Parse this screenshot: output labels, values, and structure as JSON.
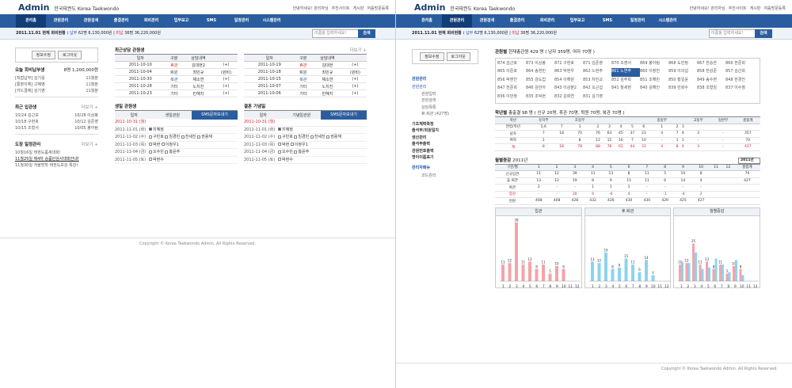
{
  "brand": {
    "admin": "Admin",
    "name_ko": "한국태권도",
    "name_en": "Korea Taekwondo"
  },
  "toplinks": [
    "안녕하세요! 관리자님",
    "추천사이트",
    "게시판",
    "처음방문등록"
  ],
  "menu": [
    "관리홈",
    "관원관리",
    "관원검색",
    "출결관리",
    "회비관리",
    "업무보고",
    "SMS",
    "일정관리",
    "시스템관리"
  ],
  "status": {
    "date": "2011.11.01 현재 회비현황 :",
    "paid_label": "납부",
    "paid": "62명",
    "paid_amt": "6,130,000원",
    "unpaid_label": "미납",
    "unpaid": "36명",
    "unpaid_amt": "36,220,000원"
  },
  "search": {
    "placeholder": "이름을 입력하세요!",
    "btn": "검색"
  },
  "login": {
    "edit": "정보수정",
    "logout": "로그아웃"
  },
  "fee_today": {
    "title": "오늘 회비납부생",
    "summary": "8명 1,200,000원",
    "rows": [
      [
        "[직접납부] 김기웅",
        "11월분"
      ],
      [
        "[통장이체] 고혜영",
        "11월분"
      ],
      [
        "[카드결제] 김기영",
        "11월분"
      ]
    ]
  },
  "new_students": {
    "title": "최근 입관생",
    "more": "더보기 +",
    "rows": [
      [
        "10/24 김근모",
        "10/28 이상봉"
      ],
      [
        "10/18 구현호",
        "10/12 김준영"
      ],
      [
        "10/15 조형서",
        "10/05 봉아림"
      ]
    ]
  },
  "schedule": {
    "title": "도장 일정관리",
    "more": "더보기 +",
    "rows": [
      "10월16일 태권도품새대회!",
      "11월25일 제4차 승품단심사대회안내!",
      "11월30일 겨울방학 태권도보강 특강!"
    ]
  },
  "consult": {
    "title": "최근상담 관원생",
    "more": "더보기 +",
    "cols": [
      "일자",
      "구분",
      "상담내역"
    ],
    "left": [
      [
        "2011-10-10",
        "휴관",
        "김대현2",
        "(+)"
      ],
      [
        "2011-10-04",
        "퇴원",
        "최민규",
        "(원비)"
      ],
      [
        "2011-10-30",
        "복관",
        "채소연",
        "(+)"
      ],
      [
        "2011-10-28",
        "기타",
        "노치진",
        "(+)"
      ],
      [
        "2011-10-23",
        "기타",
        "민혜지",
        "(+)"
      ]
    ],
    "right": [
      [
        "2011-10-19",
        "휴관",
        "김대현",
        "(+)"
      ],
      [
        "2011-10-18",
        "퇴원",
        "최민규",
        "(원비)"
      ],
      [
        "2011-10-15",
        "복관",
        "채소연",
        "(+)"
      ],
      [
        "2011-10-07",
        "기타",
        "노치진",
        "(+)"
      ],
      [
        "2011-10-06",
        "기타",
        "민혜지",
        "(+)"
      ]
    ]
  },
  "birthday": {
    "title": "생일 관원생",
    "cols": [
      "일자",
      "생일관원"
    ],
    "sms": "SMS문자보내기",
    "rows": [
      [
        "2011-10-31 (월)",
        ""
      ],
      [
        "2011-11-01 (화)",
        "지혜정"
      ],
      [
        "2011-11-02 (수)",
        "구민호  임경민  천세진  권용재"
      ],
      [
        "2011-11-03 (목)",
        "박현  이정우1"
      ],
      [
        "2011-11-04 (금)",
        "오수민  홍윤주"
      ],
      [
        "2011-11-05 (토)",
        "박현수"
      ]
    ]
  },
  "anniv": {
    "title": "결혼 기념일",
    "cols": [
      "일자",
      "기념일관원"
    ],
    "sms": "SMS문자보내기",
    "rows": [
      [
        "2011-10-31 (월)",
        ""
      ],
      [
        "2011-11-01 (화)",
        "지혜정"
      ],
      [
        "2011-11-02 (수)",
        "구민호  임경민  천세진  권용재"
      ],
      [
        "2011-11-03 (목)",
        "박현  이정우1"
      ],
      [
        "2011-11-04 (금)",
        "오수민  홍윤주"
      ],
      [
        "2011-11-05 (토)",
        "박현수"
      ]
    ]
  },
  "footer": "Copyright © Korea Taekwondo Admin. All Rights Reserved.",
  "rside": {
    "hd1": "관원관리",
    "items": [
      "관원관리",
      "관원입력",
      "관원검색",
      "상담목록",
      "휴.퇴관 (427명)"
    ],
    "bold": [
      "기초체력측정",
      "출석부/회원일지",
      "생산관리",
      "출석부출력",
      "관원번호출력",
      "명이이름표기"
    ],
    "hd2": "관리자메뉴",
    "items2": [
      "코드관리"
    ]
  },
  "roster": {
    "title": "관원별",
    "summary": "현재총관원 429 명 ( 남자 359명, 여자 70명 )",
    "names": [
      "874 김근호",
      "873 이상봉",
      "872 구현호",
      "871 김준영",
      "870 조영서",
      "869 봉아림",
      "868 도민정",
      "867 한승한",
      "866 한준희",
      "865 이준호",
      "864 송현민",
      "863 박현우",
      "862 노현주",
      "861 노연주",
      "860 이정헌",
      "859 이의섭",
      "858 전성준",
      "857 김근희",
      "856 박현진",
      "855 강도업",
      "854 이해원",
      "853 차민교",
      "852 김주희",
      "851 조해민",
      "850 황일윤",
      "849 송수현",
      "848 한경진",
      "847 전준희",
      "846 김민아",
      "843 이상분2",
      "842 오근섭",
      "841 정세현",
      "840 김해인",
      "839 민화수",
      "838 조형임",
      "837 이수정",
      "836 이민정",
      "835 조덕현",
      "832 김희연",
      "831 김기영"
    ]
  },
  "grade": {
    "title": "학년별",
    "summary": "총출결 98 명 ( 신규 20명, 휴관 70명, 퇴원 70명, 복관 70명 )",
    "cols": [
      "학년",
      "유치부",
      "",
      "초등부",
      "",
      "",
      "",
      "",
      "",
      "중등부",
      "",
      "",
      "고등부",
      "일반부",
      "총합계"
    ],
    "sub": [
      "연령/학년",
      "5,6",
      "7",
      "1",
      "2",
      "3",
      "4",
      "5",
      "6",
      "1",
      "2",
      "3",
      "",
      "",
      ""
    ],
    "rows": [
      [
        "남자",
        "7",
        "18",
        "70",
        "76",
        "63",
        "45",
        "37",
        "23",
        "4",
        "7",
        "4",
        "3",
        "-",
        "357"
      ],
      [
        "여자",
        "1",
        "-",
        "8",
        "12",
        "15",
        "16",
        "7",
        "10",
        "-",
        "1",
        "1",
        "-",
        "-",
        "70"
      ],
      [
        "계",
        "8",
        "18",
        "78",
        "88",
        "78",
        "61",
        "44",
        "33",
        "4",
        "8",
        "4",
        "3",
        "-",
        "427"
      ]
    ]
  },
  "monthly": {
    "title": "월별증감",
    "year": "2011년",
    "select": "2011년",
    "cols": [
      "구분/월",
      "1",
      "2",
      "3",
      "4",
      "5",
      "6",
      "7",
      "8",
      "9",
      "10",
      "11",
      "12",
      "총합계"
    ],
    "rows": [
      [
        "신규입관",
        "11",
        "12",
        "39",
        "11",
        "13",
        "8",
        "11",
        "5",
        "10",
        "8",
        "",
        "",
        "70"
      ],
      [
        "휴.퇴관",
        "13",
        "12",
        "19",
        "8",
        "9",
        "15",
        "11",
        "6",
        "14",
        "4",
        "",
        "",
        "427"
      ],
      [
        "복관",
        "2",
        "-",
        "-",
        "1",
        "1",
        "1",
        "-",
        "-",
        "-",
        "-",
        "",
        "",
        ""
      ],
      [
        "증감",
        "-",
        "-",
        "20",
        "4",
        "-6",
        "4",
        "-",
        "-1",
        "-4",
        "2",
        "",
        "",
        ""
      ],
      [
        "현원",
        "408",
        "408",
        "428",
        "432",
        "426",
        "430",
        "430",
        "429",
        "425",
        "427",
        "",
        "",
        ""
      ]
    ]
  },
  "chart_data": [
    {
      "type": "bar",
      "title": "입관",
      "categories": [
        "1",
        "2",
        "3",
        "4",
        "5",
        "6",
        "7",
        "8",
        "9",
        "10",
        "11",
        "12"
      ],
      "values": [
        11,
        12,
        39,
        11,
        13,
        8,
        11,
        5,
        10,
        8,
        0,
        0
      ],
      "color": "#f4a3a8"
    },
    {
      "type": "bar",
      "title": "휴.퇴관",
      "categories": [
        "1",
        "2",
        "3",
        "4",
        "5",
        "6",
        "7",
        "8",
        "9",
        "10",
        "11",
        "12"
      ],
      "values": [
        13,
        12,
        19,
        8,
        9,
        15,
        11,
        6,
        14,
        4,
        0,
        0
      ],
      "color": "#8cd3ef"
    },
    {
      "type": "bar",
      "title": "월별증감",
      "categories": [
        "1",
        "2",
        "3",
        "4",
        "5",
        "6",
        "7",
        "8",
        "9",
        "10",
        "11",
        "12"
      ],
      "series": [
        {
          "values": [
            11,
            12,
            25,
            11,
            13,
            8,
            11,
            5,
            10,
            8,
            0,
            0
          ],
          "color": "#f4a3a8"
        },
        {
          "values": [
            13,
            12,
            19,
            8,
            9,
            15,
            11,
            6,
            14,
            4,
            0,
            0
          ],
          "color": "#8cd3ef"
        }
      ]
    }
  ]
}
